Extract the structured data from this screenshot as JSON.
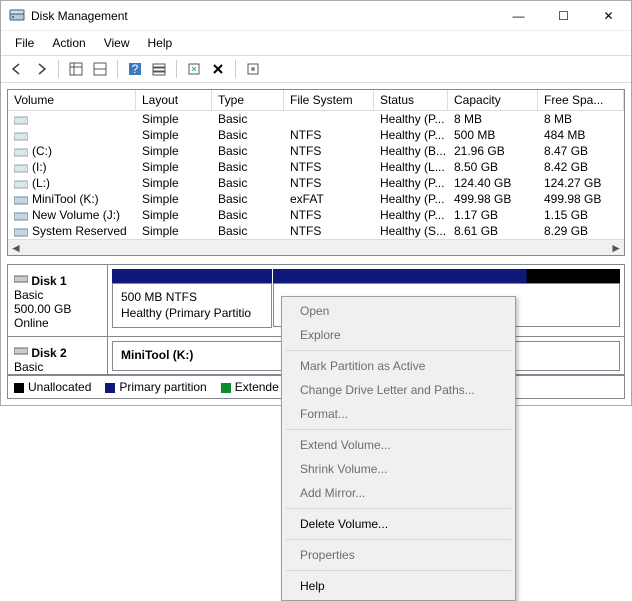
{
  "title": "Disk Management",
  "window_controls": {
    "min": "—",
    "max": "☐",
    "close": "✕"
  },
  "menubar": [
    "File",
    "Action",
    "View",
    "Help"
  ],
  "toolbar_icons": [
    "back",
    "forward",
    "table-view",
    "tree-view",
    "help",
    "list-view",
    "refresh",
    "delete",
    "properties"
  ],
  "columns": [
    "Volume",
    "Layout",
    "Type",
    "File System",
    "Status",
    "Capacity",
    "Free Spa..."
  ],
  "volumes": [
    {
      "name": "",
      "layout": "Simple",
      "type": "Basic",
      "fs": "",
      "status": "Healthy (P...",
      "cap": "8 MB",
      "free": "8 MB"
    },
    {
      "name": "",
      "layout": "Simple",
      "type": "Basic",
      "fs": "NTFS",
      "status": "Healthy (P...",
      "cap": "500 MB",
      "free": "484 MB"
    },
    {
      "name": "(C:)",
      "layout": "Simple",
      "type": "Basic",
      "fs": "NTFS",
      "status": "Healthy (B...",
      "cap": "21.96 GB",
      "free": "8.47 GB"
    },
    {
      "name": "(I:)",
      "layout": "Simple",
      "type": "Basic",
      "fs": "NTFS",
      "status": "Healthy (L...",
      "cap": "8.50 GB",
      "free": "8.42 GB"
    },
    {
      "name": "(L:)",
      "layout": "Simple",
      "type": "Basic",
      "fs": "NTFS",
      "status": "Healthy (P...",
      "cap": "124.40 GB",
      "free": "124.27 GB"
    },
    {
      "name": "MiniTool (K:)",
      "layout": "Simple",
      "type": "Basic",
      "fs": "exFAT",
      "status": "Healthy (P...",
      "cap": "499.98 GB",
      "free": "499.98 GB"
    },
    {
      "name": "New Volume (J:)",
      "layout": "Simple",
      "type": "Basic",
      "fs": "NTFS",
      "status": "Healthy (P...",
      "cap": "1.17 GB",
      "free": "1.15 GB"
    },
    {
      "name": "System Reserved",
      "layout": "Simple",
      "type": "Basic",
      "fs": "NTFS",
      "status": "Healthy (S...",
      "cap": "8.61 GB",
      "free": "8.29 GB"
    }
  ],
  "disk1": {
    "name": "Disk 1",
    "type": "Basic",
    "size": "500.00 GB",
    "state": "Online",
    "part_text1": "500 MB NTFS",
    "part_text2": "Healthy (Primary Partitio"
  },
  "disk2": {
    "name": "Disk 2",
    "type": "Basic",
    "part_label": "MiniTool  (K:)"
  },
  "legend": {
    "unalloc": "Unallocated",
    "primary": "Primary partition",
    "extended": "Extende"
  },
  "colors": {
    "primary": "#10197a",
    "unalloc": "#000000",
    "extended": "#0e8a2f"
  },
  "context": {
    "open": "Open",
    "explore": "Explore",
    "mark": "Mark Partition as Active",
    "change": "Change Drive Letter and Paths...",
    "format": "Format...",
    "extend": "Extend Volume...",
    "shrink": "Shrink Volume...",
    "mirror": "Add Mirror...",
    "delete": "Delete Volume...",
    "props": "Properties",
    "help": "Help"
  }
}
